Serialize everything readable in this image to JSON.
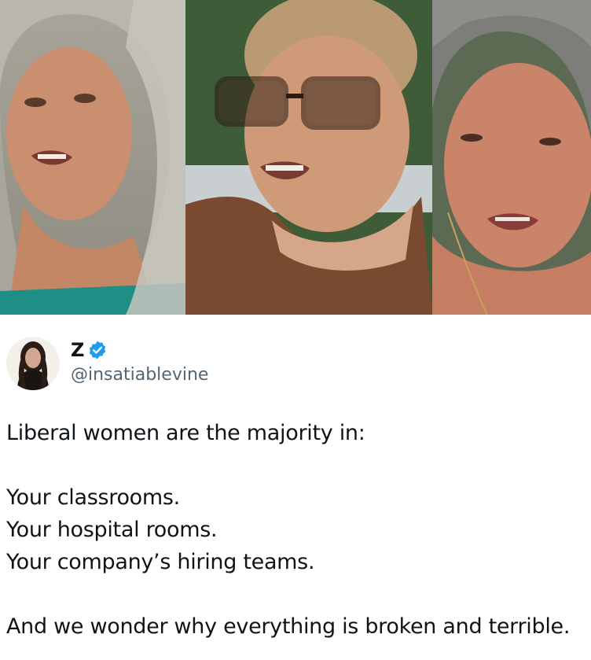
{
  "post": {
    "display_name": "Z",
    "handle": "@insatiablevine",
    "verified": true,
    "lines": [
      "Liberal women are the majority in:",
      "",
      "Your classrooms.",
      "Your hospital rooms.",
      "Your company’s hiring teams.",
      "",
      "And we wonder why everything is broken and terrible."
    ]
  },
  "icons": {
    "verified": "verified-badge-icon"
  },
  "colors": {
    "verified_blue": "#1d9bf0",
    "handle_gray": "#536471",
    "text": "#0f1419"
  }
}
